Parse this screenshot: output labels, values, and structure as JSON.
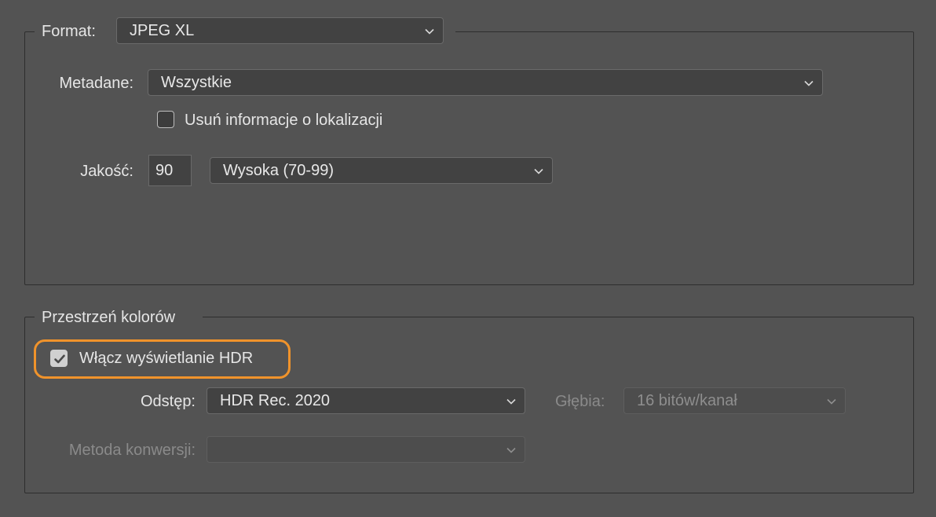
{
  "format_group": {
    "label": "Format:",
    "format_select": "JPEG XL",
    "metadata_label": "Metadane:",
    "metadata_select": "Wszystkie",
    "remove_location_label": "Usuń informacje o lokalizacji",
    "remove_location_checked": false,
    "quality_label": "Jakość:",
    "quality_value": "90",
    "quality_select": "Wysoka (70-99)"
  },
  "color_group": {
    "title": "Przestrzeń kolorów",
    "hdr_label": "Włącz wyświetlanie HDR",
    "hdr_checked": true,
    "space_label": "Odstęp:",
    "space_select": "HDR Rec. 2020",
    "depth_label": "Głębia:",
    "depth_select": "16 bitów/kanał",
    "conversion_label": "Metoda konwersji:",
    "conversion_select": ""
  },
  "colors": {
    "background": "#535353",
    "field": "#424242",
    "highlight": "#f0932b"
  }
}
